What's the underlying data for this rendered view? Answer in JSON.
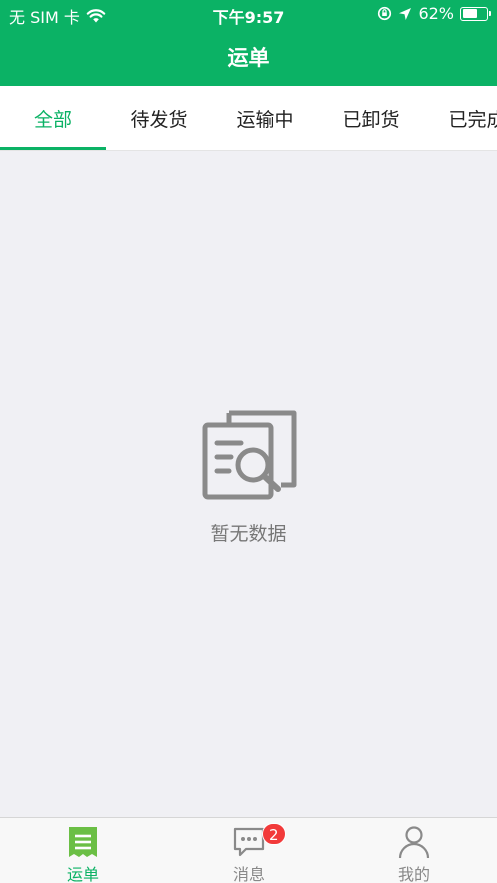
{
  "status_bar": {
    "carrier": "无 SIM 卡",
    "time": "下午9:57",
    "battery_percent": "62%",
    "battery_level": 0.62,
    "icons": [
      "wifi-icon",
      "rotation-lock-icon",
      "location-arrow-icon",
      "battery-icon"
    ]
  },
  "header": {
    "title": "运单"
  },
  "tabs": [
    {
      "label": "全部",
      "active": true
    },
    {
      "label": "待发货",
      "active": false
    },
    {
      "label": "运输中",
      "active": false
    },
    {
      "label": "已卸货",
      "active": false
    },
    {
      "label": "已完成",
      "active": false
    }
  ],
  "empty_state": {
    "text": "暂无数据",
    "icon": "document-search-icon"
  },
  "tabbar": {
    "items": [
      {
        "label": "运单",
        "icon": "waybill-icon",
        "active": true
      },
      {
        "label": "消息",
        "icon": "message-icon",
        "active": false,
        "badge": "2"
      },
      {
        "label": "我的",
        "icon": "user-icon",
        "active": false
      }
    ]
  },
  "colors": {
    "accent": "#0bb265",
    "badge": "#f23a3a",
    "background": "#f0f0f4"
  }
}
